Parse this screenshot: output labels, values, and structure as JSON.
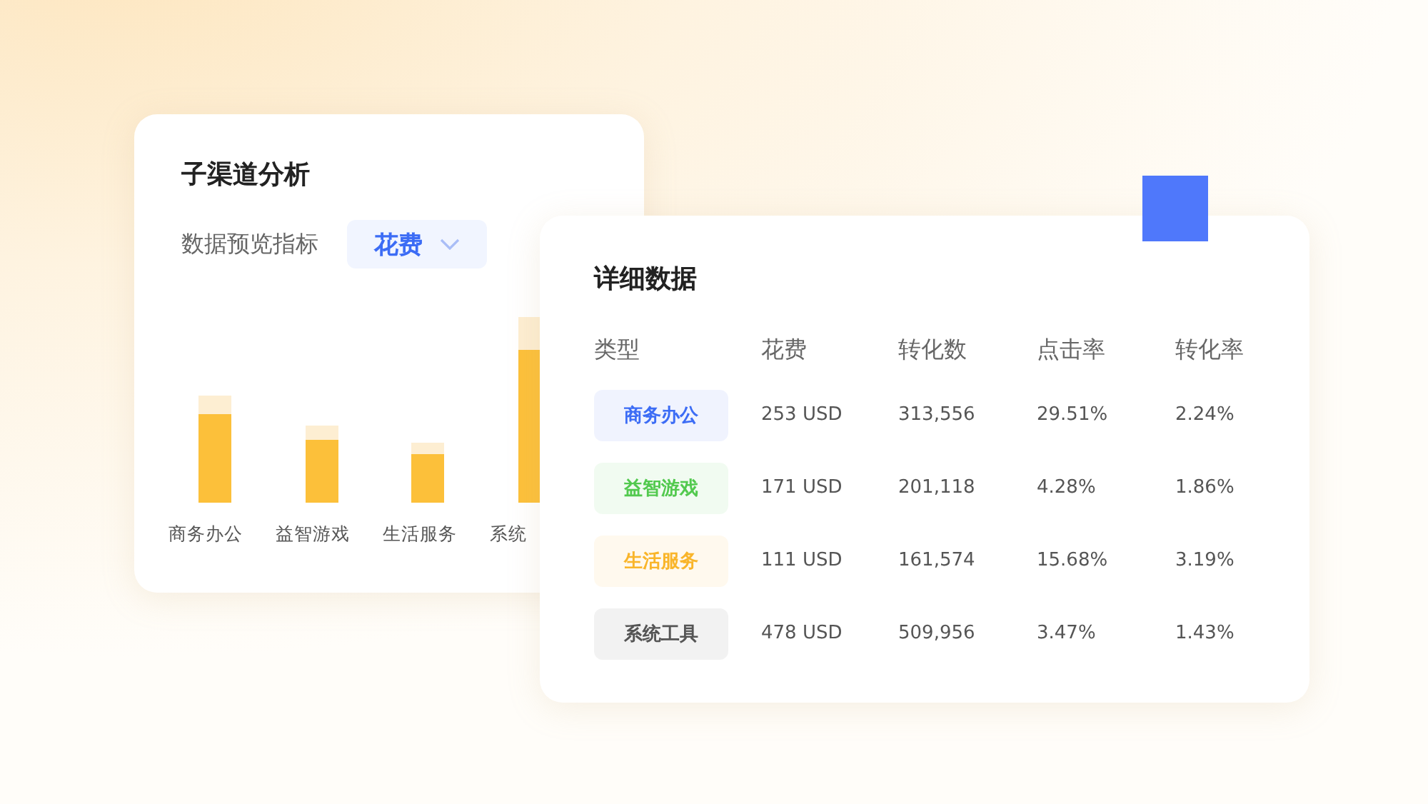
{
  "channel_card": {
    "title": "子渠道分析",
    "metric_label": "数据预览指标",
    "metric_dropdown": {
      "value": "花费"
    },
    "categories": [
      "商务办公",
      "益智游戏",
      "生活服务",
      "系统"
    ]
  },
  "detail_card": {
    "title": "详细数据",
    "columns": [
      "类型",
      "花费",
      "转化数",
      "点击率",
      "转化率"
    ],
    "rows": [
      {
        "type": "商务办公",
        "color": "#3c6cf5",
        "spend": "253 USD",
        "conversions": "313,556",
        "ctr": "29.51%",
        "cvr": "2.24%"
      },
      {
        "type": "益智游戏",
        "color": "#52c94e",
        "spend": "171 USD",
        "conversions": "201,118",
        "ctr": "4.28%",
        "cvr": "1.86%"
      },
      {
        "type": "生活服务",
        "color": "#f9b52a",
        "spend": "111 USD",
        "conversions": "161,574",
        "ctr": "15.68%",
        "cvr": "3.19%"
      },
      {
        "type": "系统工具",
        "color": "#555555",
        "spend": "478 USD",
        "conversions": "509,956",
        "ctr": "3.47%",
        "cvr": "1.43%"
      }
    ]
  }
}
